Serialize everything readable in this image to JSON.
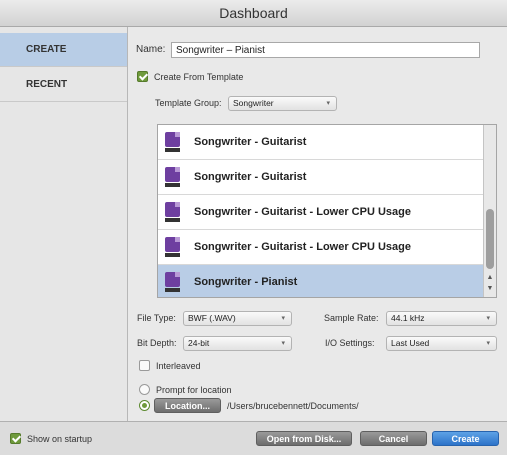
{
  "window": {
    "title": "Dashboard"
  },
  "sidebar": {
    "items": [
      {
        "label": "CREATE",
        "active": true
      },
      {
        "label": "RECENT",
        "active": false
      }
    ]
  },
  "form": {
    "name_label": "Name:",
    "name_value": "Songwriter – Pianist",
    "create_from_template_label": "Create From Template",
    "create_from_template_checked": true,
    "template_group_label": "Template Group:",
    "template_group_value": "Songwriter"
  },
  "templates": [
    {
      "name": "Songwriter - Guitarist",
      "selected": false
    },
    {
      "name": "Songwriter - Guitarist",
      "selected": false
    },
    {
      "name": "Songwriter - Guitarist - Lower CPU Usage",
      "selected": false
    },
    {
      "name": "Songwriter - Guitarist - Lower CPU Usage",
      "selected": false
    },
    {
      "name": "Songwriter - Pianist",
      "selected": true
    }
  ],
  "settings": {
    "file_type_label": "File Type:",
    "file_type_value": "BWF (.WAV)",
    "sample_rate_label": "Sample Rate:",
    "sample_rate_value": "44.1 kHz",
    "bit_depth_label": "Bit Depth:",
    "bit_depth_value": "24-bit",
    "io_settings_label": "I/O Settings:",
    "io_settings_value": "Last Used",
    "interleaved_label": "Interleaved",
    "interleaved_checked": false
  },
  "location": {
    "prompt_label": "Prompt for location",
    "location_button": "Location...",
    "path": "/Users/brucebennett/Documents/"
  },
  "footer": {
    "show_on_startup_label": "Show on startup",
    "show_on_startup_checked": true,
    "open_from_disk": "Open from Disk...",
    "cancel": "Cancel",
    "create": "Create"
  },
  "colors": {
    "accent_blue": "#2c73c9",
    "selection": "#b9cde6",
    "check_green": "#6f9a3c",
    "template_icon": "#6e3fa0"
  },
  "icons": {
    "template": "template-file-icon",
    "chevron": "chevron-updown-icon"
  }
}
